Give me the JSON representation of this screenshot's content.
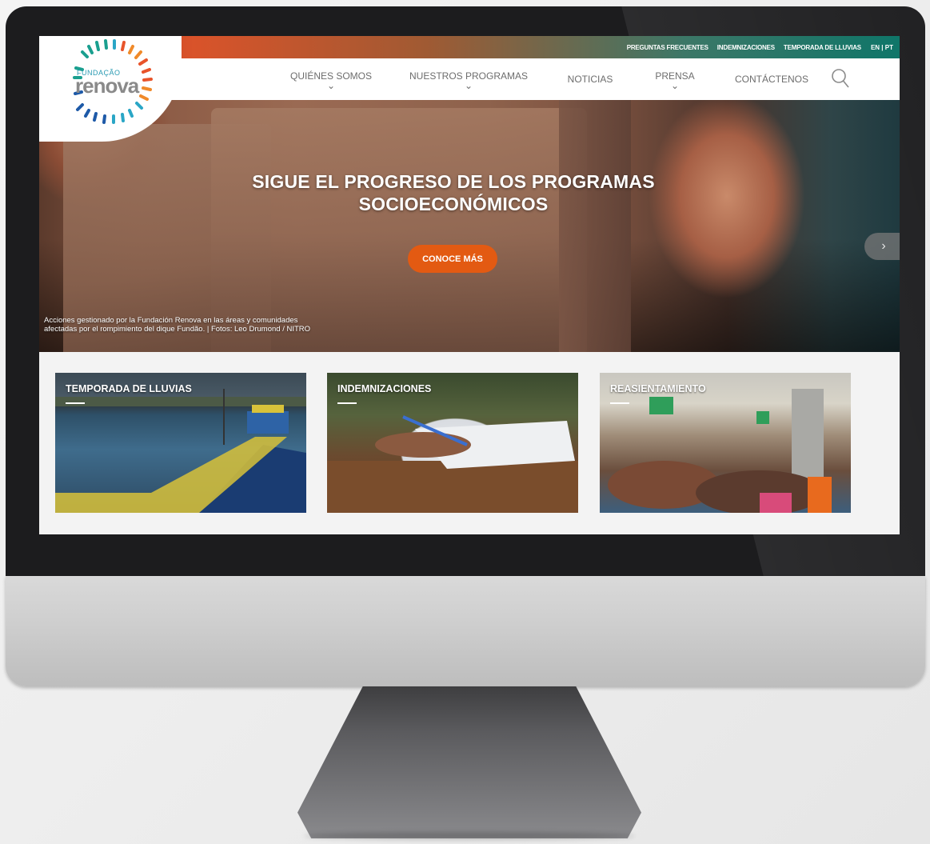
{
  "brand": {
    "logo_small": "FUNDAÇÃO",
    "logo_name": "renova"
  },
  "topbar": {
    "links": [
      "PREGUNTAS FRECUENTES",
      "INDEMNIZACIONES",
      "TEMPORADA DE LLUVIAS"
    ],
    "lang_en": "EN",
    "lang_sep": " | ",
    "lang_pt": "PT"
  },
  "nav": {
    "items": [
      {
        "label": "QUIÉNES SOMOS",
        "chevron": "⌄"
      },
      {
        "label": "NUESTROS PROGRAMAS",
        "chevron": "⌄"
      },
      {
        "label": "NOTICIAS",
        "chevron": ""
      },
      {
        "label": "PRENSA",
        "chevron": "⌄"
      },
      {
        "label": "CONTÁCTENOS",
        "chevron": ""
      }
    ]
  },
  "hero": {
    "title_line1": "SIGUE EL PROGRESO DE LOS PROGRAMAS",
    "title_line2": "SOCIOECONÓMICOS",
    "cta": "CONOCE MÁS",
    "next": "›",
    "caption_line1": "Acciones gestionado por la Fundación Renova en las áreas y comunidades",
    "caption_line2": "afectadas por el rompimiento del dique Fundão. | Fotos: Leo Drumond / NITRO"
  },
  "cards": [
    {
      "title": "TEMPORADA DE LLUVIAS"
    },
    {
      "title": "INDEMNIZACIONES"
    },
    {
      "title": "REASIENTAMIENTO"
    }
  ],
  "colors": {
    "accent_orange": "#e35a12",
    "teal": "#0f7669"
  }
}
